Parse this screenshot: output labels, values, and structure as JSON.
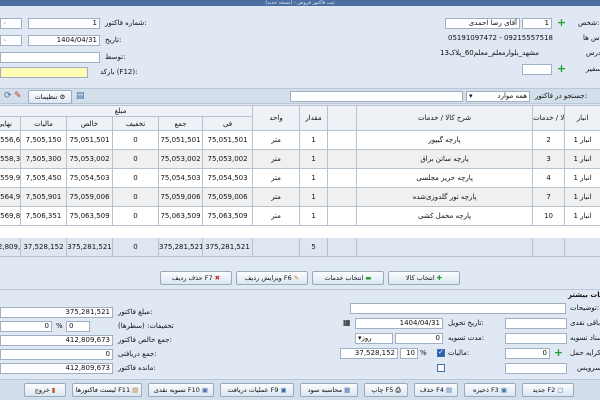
{
  "window": {
    "title": "ثبت فاکتور فروش - (نسخه جدید)"
  },
  "header": {
    "person_label": "شخص:",
    "person_code": "1",
    "person_name": "آقای رضا احمدی",
    "phone_label": "تماس ها:",
    "phones": "05191097472 - 09215557518",
    "address_label": "آدرس:",
    "address": "مشهد_بلوارمعلم_معلم60_پلاک13",
    "other_label": "سفیر:",
    "invoice_no_label": "شماره فاکتور:",
    "invoice_no": "1",
    "date_label": "تاریخ:",
    "date": "1404/04/31",
    "mediator_label": "توسط:",
    "barcode_label": "بارکد (F12):",
    "left_value_1": "۰",
    "left_value_2": "۰"
  },
  "toolbar": {
    "settings_label": "تنظیمات",
    "search_label": "جستجو در فاکتور:",
    "search_option": "همه موارد"
  },
  "table": {
    "group_header": "مبلغ",
    "columns": {
      "warehouse": "انبار",
      "code": "کد کالا / خدمات",
      "desc": "شرح کالا / خدمات",
      "qty": "مقدار",
      "unit": "واحد",
      "fee": "فی",
      "sum": "جمع",
      "discount": "تخفیف",
      "net": "خالص",
      "tax": "مالیات",
      "final": "نهایی"
    },
    "rows": [
      {
        "warehouse": "انبار 1",
        "code": "2",
        "desc": "پارچه گیپور",
        "qty": "1",
        "unit": "متر",
        "fee": "75,051,501",
        "sum": "75,051,501",
        "discount": "0",
        "net": "75,051,501",
        "tax": "7,505,150",
        "final": "82,556,651"
      },
      {
        "warehouse": "انبار 1",
        "code": "3",
        "desc": "پارچه ساتن براق",
        "qty": "1",
        "unit": "متر",
        "fee": "75,053,002",
        "sum": "75,053,002",
        "discount": "0",
        "net": "75,053,002",
        "tax": "7,505,300",
        "final": "82,558,302"
      },
      {
        "warehouse": "انبار 1",
        "code": "4",
        "desc": "پارچه حریر مجلسی",
        "qty": "1",
        "unit": "متر",
        "fee": "75,054,503",
        "sum": "75,054,503",
        "discount": "0",
        "net": "75,054,503",
        "tax": "7,505,450",
        "final": "82,559,953"
      },
      {
        "warehouse": "انبار 1",
        "code": "7",
        "desc": "پارچه تور گلدوزی‌شده",
        "qty": "1",
        "unit": "متر",
        "fee": "75,059,006",
        "sum": "75,059,006",
        "discount": "0",
        "net": "75,059,006",
        "tax": "7,505,901",
        "final": "82,564,907"
      },
      {
        "warehouse": "انبار 1",
        "code": "10",
        "desc": "پارچه مخمل کشی",
        "qty": "1",
        "unit": "متر",
        "fee": "75,063,509",
        "sum": "75,063,509",
        "discount": "0",
        "net": "75,063,509",
        "tax": "7,506,351",
        "final": "82,569,860"
      }
    ],
    "totals": {
      "qty": "5",
      "fee": "375,281,521",
      "sum": "375,281,521",
      "discount": "0",
      "net": "375,281,521",
      "tax": "37,528,152",
      "final": "412,809,673"
    }
  },
  "row_actions": {
    "select_goods": "انتخاب کالا",
    "select_services": "انتخاب خدمات",
    "edit_row": "ویرایش ردیف F6",
    "delete_row": "حذف ردیف F7"
  },
  "info": {
    "section_title": "اطلاعات بیشتر",
    "desc_label": "توضیحات:",
    "delivery_date_label": "تاریخ تحویل:",
    "delivery_date": "1404/04/31",
    "due_label": "مدت تسویه:",
    "due_value": "0",
    "due_unit": "روز",
    "tax_label": "مالیات:",
    "tax_percent": "10",
    "tax_amount": "37,528,152",
    "transport_label": "کرایه حمل:",
    "transport_value": "0",
    "service_label": "سرویس:",
    "cash_rest_label": "باقی نقدی:",
    "settle_doc_label": "اسناد تسویه:",
    "invoice_amount_label": "مبلغ فاکتور:",
    "invoice_amount": "375,281,521",
    "discounts_label": "تخفیفات: (سطرها)",
    "discount_percent": "0",
    "discount_amount": "0",
    "net_total_label": "جمع خالص فاکتور:",
    "net_total": "412,809,673",
    "received_label": "جمع دریافتی:",
    "received": "0",
    "remain_label": "مانده فاکتور:",
    "remain": "412,809,673"
  },
  "bottom": {
    "new": "جدید F2",
    "save": "ذخیره F3",
    "delete": "حذف F4",
    "print": "چاپ F5",
    "profit": "محاسبه سود",
    "receipts": "عملیات دریافت F9",
    "cash_settle": "تسویه نقدی F10",
    "invoice_list": "لیست فاکتورها F11",
    "exit": "خروج"
  }
}
